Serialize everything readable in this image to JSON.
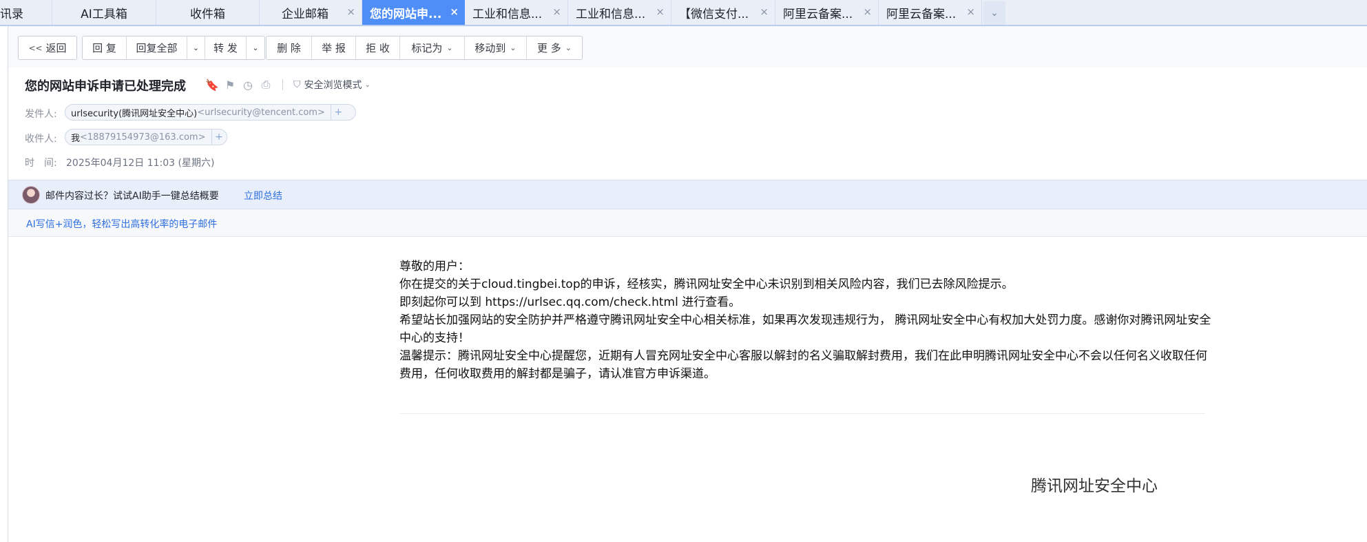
{
  "tabs": [
    {
      "label": "讯录",
      "closable": false,
      "active": false
    },
    {
      "label": "AI工具箱",
      "closable": false,
      "active": false
    },
    {
      "label": "收件箱",
      "closable": false,
      "active": false
    },
    {
      "label": "企业邮箱",
      "closable": true,
      "active": false
    },
    {
      "label": "您的网站申...",
      "closable": true,
      "active": true
    },
    {
      "label": "工业和信息...",
      "closable": true,
      "active": false
    },
    {
      "label": "工业和信息...",
      "closable": true,
      "active": false
    },
    {
      "label": "【微信支付...",
      "closable": true,
      "active": false
    },
    {
      "label": "阿里云备案...",
      "closable": true,
      "active": false
    },
    {
      "label": "阿里云备案...",
      "closable": true,
      "active": false
    }
  ],
  "icons": {
    "tab_close": "×",
    "tab_more": "⌄",
    "back": "<<",
    "dropdown": "⌄",
    "bookmark": "🔖",
    "flag": "⚑",
    "clock": "◷",
    "print": "⎙",
    "shield": "⛉",
    "plus": "+"
  },
  "toolbar": {
    "back": "返回",
    "reply": "回 复",
    "reply_all": "回复全部",
    "forward": "转 发",
    "delete": "删 除",
    "report": "举 报",
    "reject": "拒 收",
    "mark_as": "标记为",
    "move_to": "移动到",
    "more": "更 多"
  },
  "header": {
    "subject": "您的网站申诉申请已处理完成",
    "safe_mode": "安全浏览模式",
    "from_label": "发件人:",
    "from_name": "urlsecurity(腾讯网址安全中心)",
    "from_addr": "<urlsecurity@tencent.com>",
    "to_label": "收件人:",
    "to_name": "我",
    "to_addr": "<18879154973@163.com>",
    "time_label": "时　间:",
    "time_value": "2025年04月12日 11:03 (星期六)"
  },
  "ai_bar": {
    "text": "邮件内容过长？试试AI助手一键总结概要",
    "link": "立即总结"
  },
  "promo": {
    "link": "AI写信+润色，轻松写出高转化率的电子邮件"
  },
  "body": {
    "greeting": "尊敬的用户：",
    "line1": "你在提交的关于cloud.tingbei.top的申诉，经核实，腾讯网址安全中心未识别到相关风险内容，我们已去除风险提示。",
    "line2": "即刻起你可以到 https://urlsec.qq.com/check.html 进行查看。",
    "line3": "希望站长加强网站的安全防护并严格遵守腾讯网址安全中心相关标准，如果再次发现违规行为， 腾讯网址安全中心有权加大处罚力度。感谢你对腾讯网址安全中心的支持！",
    "line4": "温馨提示：腾讯网址安全中心提醒您，近期有人冒充网址安全中心客服以解封的名义骗取解封费用，我们在此申明腾讯网址安全中心不会以任何名义收取任何费用，任何收取费用的解封都是骗子，请认准官方申诉渠道。",
    "signature": "腾讯网址安全中心"
  }
}
